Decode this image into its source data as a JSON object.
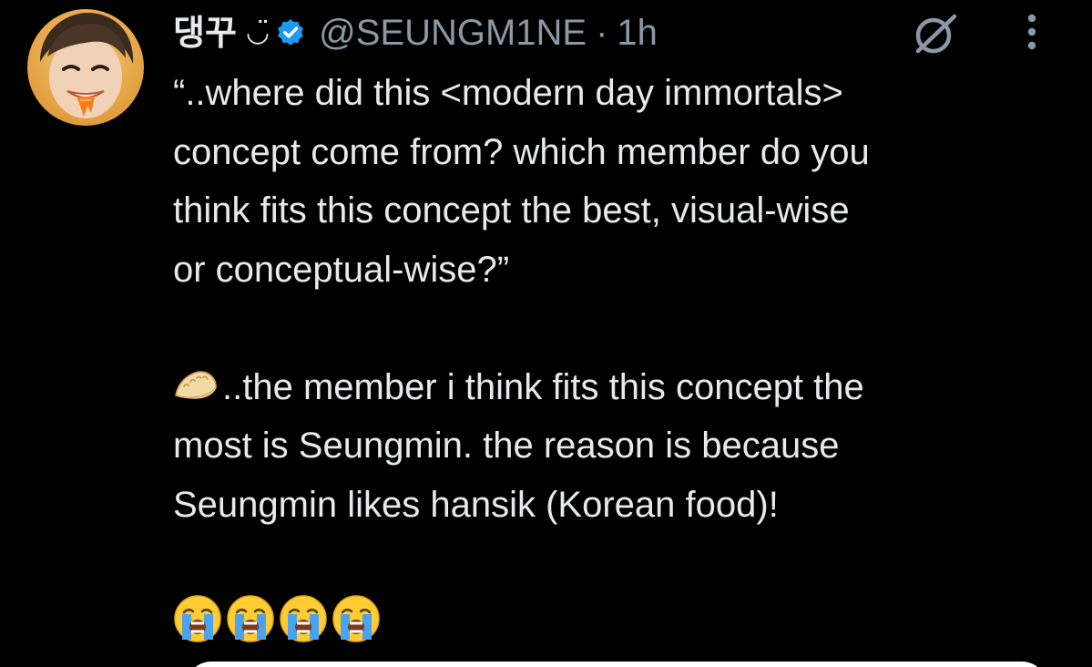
{
  "tweet": {
    "display_name": "댕꾸",
    "name_emoticon": "◡̈",
    "handle": "@SEUNGM1NE",
    "separator": "·",
    "time": "1h",
    "paragraph_1_lines": [
      "“..where did this <modern day immortals>",
      "concept come from? which member do you",
      "think fits this concept the best, visual-wise",
      "or conceptual-wise?”"
    ],
    "paragraph_2_first_line": "..the member i think fits this concept the",
    "paragraph_2_lines": [
      "most is Seungmin. the reason is because",
      "Seungmin likes hansik (Korean food)!"
    ],
    "emojis": [
      "crying-face",
      "crying-face",
      "crying-face",
      "crying-face"
    ]
  },
  "icons": {
    "verified": "verified-badge-icon",
    "grok": "grok-icon",
    "more": "more-options-icon",
    "dumpling": "dumpling-icon"
  },
  "colors": {
    "background": "#000000",
    "text": "#e7e9ea",
    "secondary_text": "#8b98a5",
    "verified_blue": "#1d9bf0"
  }
}
